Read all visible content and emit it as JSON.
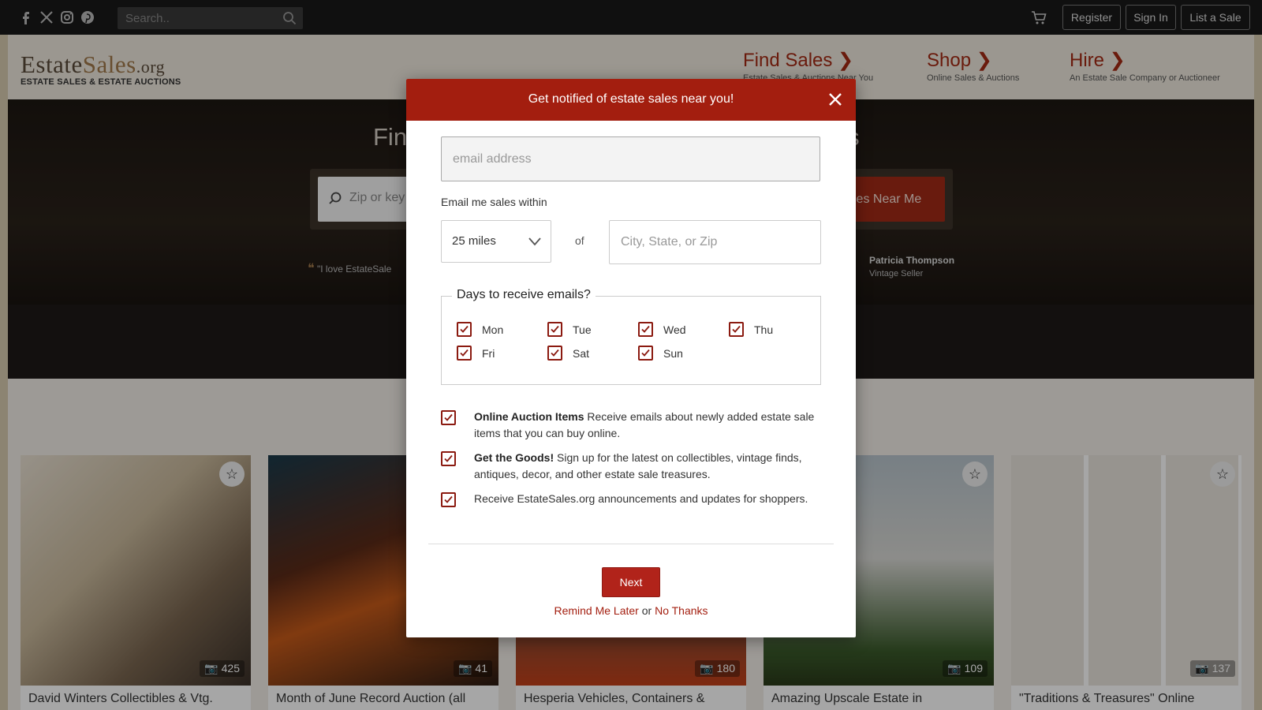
{
  "topbar": {
    "social_icons": [
      "facebook-icon",
      "x-icon",
      "instagram-icon",
      "pinterest-icon"
    ],
    "search_placeholder": "Search..",
    "register_label": "Register",
    "signin_label": "Sign In",
    "list_sale_label": "List a Sale"
  },
  "header": {
    "logo_part1": "Estate",
    "logo_part2": "Sales",
    "logo_part3": ".org",
    "logo_tagline": "ESTATE SALES & ESTATE AUCTIONS",
    "nav": [
      {
        "title": "Find Sales ❯",
        "sub": "Estate Sales & Auctions Near You"
      },
      {
        "title": "Shop ❯",
        "sub": "Online Sales & Auctions"
      },
      {
        "title": "Hire ❯",
        "sub": "An Estate Sale Company or Auctioneer"
      }
    ]
  },
  "hero": {
    "title_left": "Fin",
    "title_right": "ies",
    "search_placeholder": "Zip or key",
    "search_button": "les Near Me",
    "quote": "\"I love EstateSale",
    "person_name": "Patricia Thompson",
    "person_role": "Vintage Seller"
  },
  "cards": [
    {
      "title": "David Winters Collectibles & Vtg.",
      "photos": "425"
    },
    {
      "title": "Month of June Record Auction (all",
      "photos": "41"
    },
    {
      "title": "Hesperia Vehicles, Containers &",
      "photos": "180"
    },
    {
      "title": "Amazing Upscale Estate in",
      "photos": "109"
    },
    {
      "title": "\"Traditions & Treasures\" Online",
      "photos": "137"
    }
  ],
  "modal": {
    "title": "Get notified of estate sales near you!",
    "email_placeholder": "email address",
    "within_label": "Email me sales within",
    "miles_value": "25 miles",
    "of_label": "of",
    "city_placeholder": "City, State, or Zip",
    "days_legend": "Days to receive emails?",
    "days": [
      {
        "label": "Mon",
        "checked": true
      },
      {
        "label": "Tue",
        "checked": true
      },
      {
        "label": "Wed",
        "checked": true
      },
      {
        "label": "Thu",
        "checked": true
      },
      {
        "label": "Fri",
        "checked": true
      },
      {
        "label": "Sat",
        "checked": true
      },
      {
        "label": "Sun",
        "checked": true
      }
    ],
    "options": [
      {
        "bold": "Online Auction Items",
        "text": " Receive emails about newly added estate sale items that you can buy online.",
        "checked": true
      },
      {
        "bold": "Get the Goods!",
        "text": " Sign up for the latest on collectibles, vintage finds, antiques, decor, and other estate sale treasures.",
        "checked": true
      },
      {
        "bold": "",
        "text": "Receive EstateSales.org announcements and updates for shoppers.",
        "checked": true
      }
    ],
    "next_label": "Next",
    "remind_label": "Remind Me Later",
    "or_label": "or",
    "no_thanks_label": "No Thanks"
  },
  "colors": {
    "accent": "#a31e0f",
    "topbar": "#1a1a1a",
    "checkbox": "#8b1a10"
  }
}
